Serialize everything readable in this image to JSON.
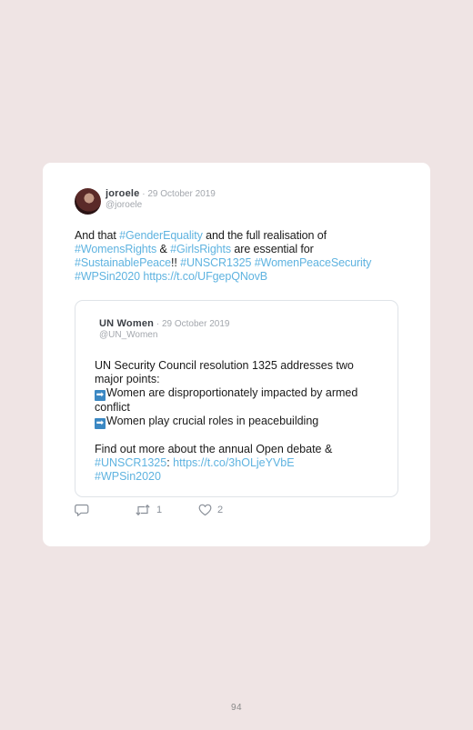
{
  "tweet": {
    "author": "joroele",
    "date": " · 29 October 2019",
    "handle": "@joroele",
    "text": {
      "l1_a": "And that ",
      "l1_link": "#GenderEquality",
      "l1_b": " and the full realisation of",
      "l2_link1": "#WomensRights",
      "l2_a": " & ",
      "l2_link2": "#GirlsRights",
      "l2_b": " are essential for",
      "l3_link1": "#SustainablePeace",
      "l3_a": "!! ",
      "l3_link2": "#UNSCR1325",
      "l3_b": " ",
      "l3_link3": "#WomenPeaceSecurity",
      "l4_link1": "#WPSin2020",
      "l4_a": " ",
      "l4_link2": "https://t.co/UFgepQNovB"
    },
    "quote": {
      "author": "UN Women",
      "date": " · 29 October 2019",
      "handle": "@UN_Women",
      "l1": "UN Security Council resolution 1325 addresses two",
      "l2": "major points:",
      "arrow": "➡",
      "l3": "Women are disproportionately impacted by armed",
      "l4": "conflict",
      "l5": "Women play crucial roles in peacebuilding",
      "l6": "Find out more about the annual Open debate &",
      "l7_link1": "#UNSCR1325",
      "l7_a": ": ",
      "l7_link2": "https://t.co/3hOLjeYVbE",
      "l8_link": "#WPSin2020"
    },
    "actions": {
      "reply_icon": "speech-bubble",
      "retweet_icon": "retweet-arrows",
      "retweets": "1",
      "like_icon": "heart",
      "likes": "2"
    }
  },
  "page_number": "94",
  "colors": {
    "background": "#efe4e4",
    "link": "#5fb3e0",
    "arrow_emoji": "#3b88c3"
  }
}
